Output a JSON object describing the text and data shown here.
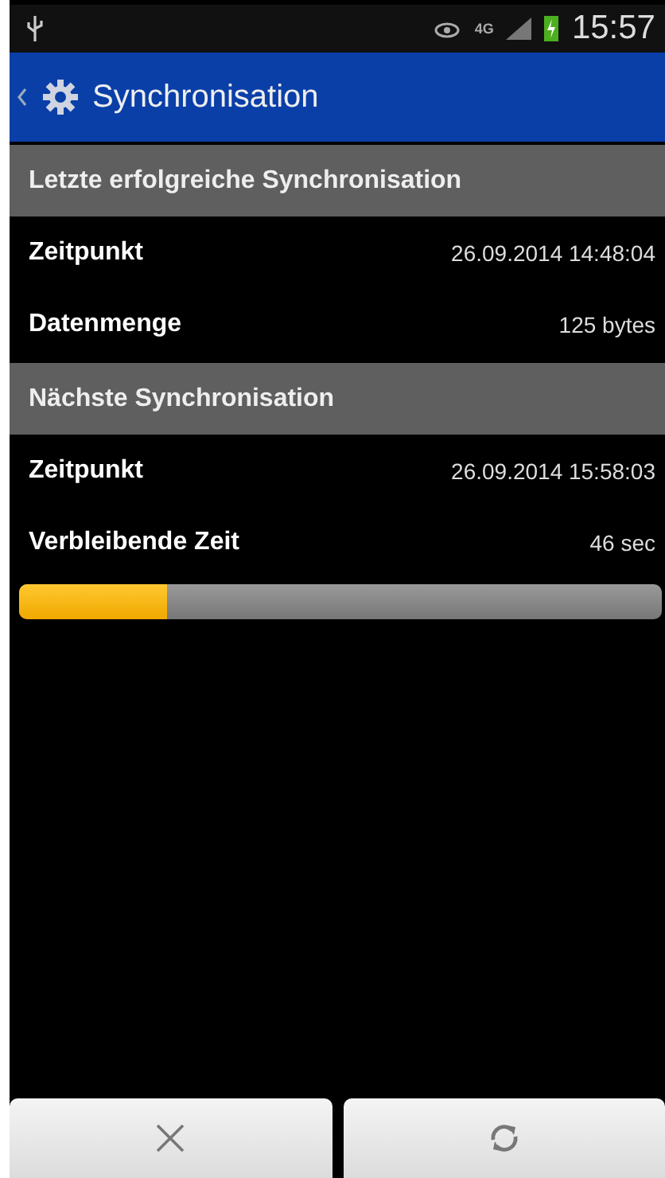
{
  "status_bar": {
    "network": "4G",
    "time": "15:57"
  },
  "app_bar": {
    "title": "Synchronisation"
  },
  "sections": [
    {
      "title": "Letzte erfolgreiche Synchronisation",
      "rows": [
        {
          "label": "Zeitpunkt",
          "value": "26.09.2014 14:48:04"
        },
        {
          "label": "Datenmenge",
          "value": "125 bytes"
        }
      ]
    },
    {
      "title": "Nächste Synchronisation",
      "rows": [
        {
          "label": "Zeitpunkt",
          "value": "26.09.2014 15:58:03"
        },
        {
          "label": "Verbleibende Zeit",
          "value": "46 sec"
        }
      ]
    }
  ],
  "progress": {
    "level": 0.23
  },
  "buttons": [
    {
      "kind": "cancel"
    },
    {
      "kind": "refresh"
    }
  ]
}
